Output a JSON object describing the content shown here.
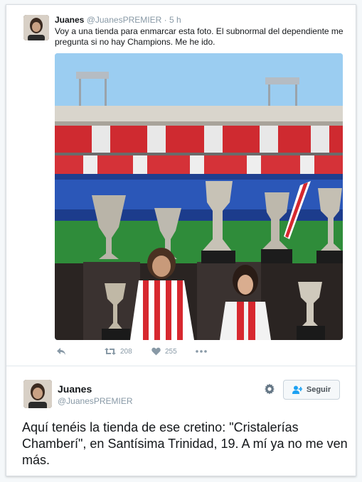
{
  "tweet1": {
    "name": "Juanes",
    "handle": "@JuanesPREMIER",
    "separator": "·",
    "time": "5 h",
    "text": "Voy a una tienda para enmarcar esta foto. El subnormal del dependiente me pregunta si no hay Champions. Me he ido.",
    "actions": {
      "reply_icon": "reply-icon",
      "retweet_icon": "retweet-icon",
      "retweets": "208",
      "like_icon": "heart-icon",
      "likes": "255",
      "more_icon": "more-icon"
    }
  },
  "tweet2": {
    "name": "Juanes",
    "handle": "@JuanesPREMIER",
    "follow_label": "Seguir",
    "text": "Aquí tenéis la tienda de ese cretino: \"Cristalerías Chamberí\", en Santísima Trinidad, 19. A mí ya no me ven más."
  },
  "colors": {
    "secondary_text": "#8899a6",
    "border": "#e1e8ed",
    "stadium_red": "#d7282f",
    "pitch_green": "#2f8c3a"
  }
}
